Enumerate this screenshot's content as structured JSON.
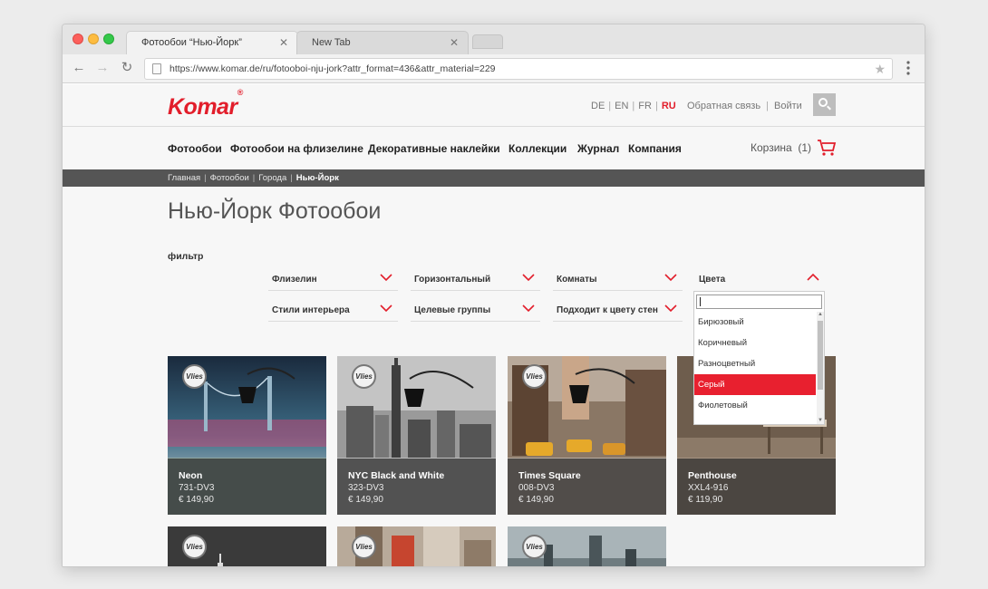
{
  "browser": {
    "tabs": [
      {
        "title": "Фотообои “Нью-Йорк”",
        "close": "✕"
      },
      {
        "title": "New Tab",
        "close": "✕"
      }
    ],
    "url": "https://www.komar.de/ru/fotooboi-nju-jork?attr_format=436&attr_material=229",
    "back": "←",
    "forward": "→",
    "reload": "↻",
    "star": "★"
  },
  "header": {
    "logo": "Komar",
    "logo_mark": "®",
    "languages": [
      "DE",
      "EN",
      "FR",
      "RU"
    ],
    "active_language": "RU",
    "feedback": "Обратная связь",
    "login": "Войти",
    "account_sep": "|"
  },
  "nav": {
    "items": [
      "Фотообои",
      "Фотообои на флизелине",
      "Декоративные наклейки",
      "Коллекции",
      "Журнал",
      "Компания"
    ],
    "cart_label": "Корзина",
    "cart_count": "(1)"
  },
  "breadcrumb": {
    "items": [
      "Главная",
      "Фотообои",
      "Города"
    ],
    "current": "Нью-Йорк",
    "sep": "|"
  },
  "page_title": "Нью-Йорк Фотообои",
  "filters": {
    "label": "фильтр",
    "row1": [
      "Флизелин",
      "Горизонтальный",
      "Комнаты",
      "Цвета"
    ],
    "row2": [
      "Стили интерьера",
      "Целевые группы",
      "Подходит к цвету стен"
    ]
  },
  "color_dropdown": {
    "options": [
      "Бирюзовый",
      "Коричневый",
      "Разноцветный",
      "Серый",
      "Фиолетовый"
    ],
    "selected": "Серый"
  },
  "badge_text": "Vlies",
  "products": [
    {
      "name": "Neon",
      "code": "731-DV3",
      "price": "€ 149,90"
    },
    {
      "name": "NYC Black and White",
      "code": "323-DV3",
      "price": "€ 149,90"
    },
    {
      "name": "Times Square",
      "code": "008-DV3",
      "price": "€ 149,90"
    },
    {
      "name": "Penthouse",
      "code": "XXL4-916",
      "price": "€ 119,90"
    }
  ],
  "colors": {
    "brand": "#e21e2b",
    "selected_option": "#e8202f",
    "breadcrumb_bg": "#555555"
  }
}
